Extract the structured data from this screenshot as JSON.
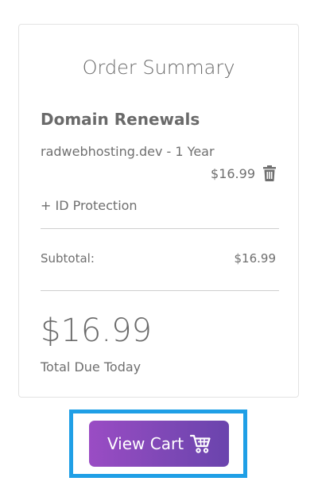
{
  "summary": {
    "title": "Order Summary",
    "section_heading": "Domain Renewals",
    "item": {
      "name": "radwebhosting.dev - 1 Year",
      "price": "$16.99",
      "delete_icon": "trash-icon"
    },
    "addon": "+ ID Protection",
    "subtotal_label": "Subtotal:",
    "subtotal_value": "$16.99",
    "total_amount": "$16.99",
    "total_label": "Total Due Today"
  },
  "actions": {
    "view_cart_label": "View Cart",
    "view_cart_icon": "shopping-cart-icon"
  },
  "colors": {
    "button_gradient_start": "#9a4cc4",
    "button_gradient_end": "#6a44ad",
    "highlight_border": "#1f9fe6",
    "text": "#6f6f6f"
  }
}
